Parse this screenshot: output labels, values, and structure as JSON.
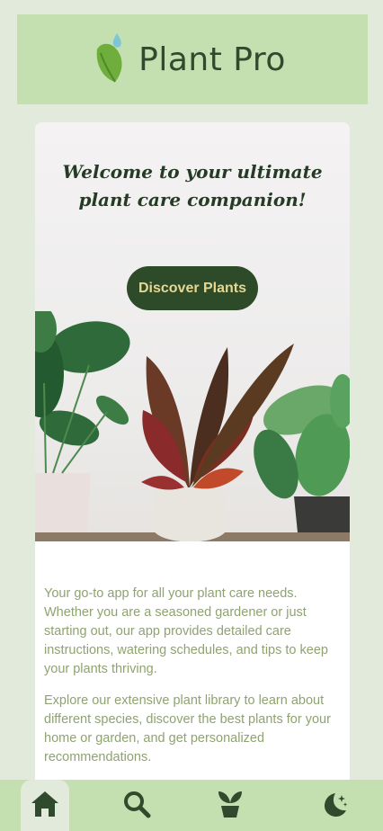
{
  "header": {
    "title": "Plant Pro",
    "logo_icon": "leaf-icon"
  },
  "hero": {
    "headline": "Welcome to your ultimate plant care companion!",
    "cta_label": "Discover Plants",
    "image": "potted-houseplants-photo"
  },
  "intro": {
    "paragraphs": [
      "Your go-to app for all your plant care needs. Whether you are a seasoned gardener or just starting out, our app provides detailed care instructions, watering schedules, and tips to keep your plants thriving.",
      "Explore our extensive plant library to learn about different species, discover the best plants for your home or garden, and get personalized recommendations."
    ]
  },
  "nav": {
    "items": [
      {
        "icon": "home-icon",
        "active": true
      },
      {
        "icon": "search-icon",
        "active": false
      },
      {
        "icon": "potted-plant-icon",
        "active": false
      },
      {
        "icon": "moon-stars-icon",
        "active": false
      }
    ]
  },
  "colors": {
    "header_bg": "#c4dfb0",
    "page_bg": "#e2eadb",
    "brand_text": "#2f4a2c",
    "cta_bg": "#2d4a29",
    "cta_text": "#e6d792",
    "body_text": "#8fa370"
  }
}
